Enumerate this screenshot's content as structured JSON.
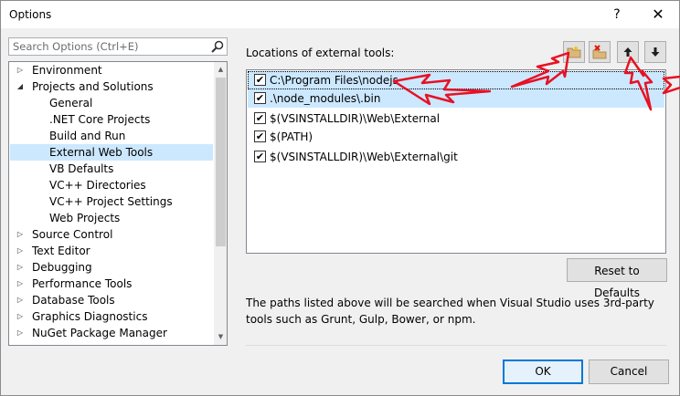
{
  "window": {
    "title": "Options",
    "help_glyph": "?",
    "close_glyph": "✕"
  },
  "search": {
    "placeholder": "Search Options (Ctrl+E)"
  },
  "tree": {
    "items": [
      {
        "label": "Environment",
        "expander": "▷"
      },
      {
        "label": "Projects and Solutions",
        "expander": "◢"
      },
      {
        "label": "General",
        "expander": ""
      },
      {
        "label": ".NET Core Projects",
        "expander": ""
      },
      {
        "label": "Build and Run",
        "expander": ""
      },
      {
        "label": "External Web Tools",
        "expander": "",
        "selected": true
      },
      {
        "label": "VB Defaults",
        "expander": ""
      },
      {
        "label": "VC++ Directories",
        "expander": ""
      },
      {
        "label": "VC++ Project Settings",
        "expander": ""
      },
      {
        "label": "Web Projects",
        "expander": ""
      },
      {
        "label": "Source Control",
        "expander": "▷"
      },
      {
        "label": "Text Editor",
        "expander": "▷"
      },
      {
        "label": "Debugging",
        "expander": "▷"
      },
      {
        "label": "Performance Tools",
        "expander": "▷"
      },
      {
        "label": "Database Tools",
        "expander": "▷"
      },
      {
        "label": "Graphics Diagnostics",
        "expander": "▷"
      },
      {
        "label": "NuGet Package Manager",
        "expander": "▷"
      }
    ]
  },
  "external_tools": {
    "label": "Locations of external tools:",
    "paths": [
      {
        "path": "C:\\Program Files\\nodejs",
        "checked": "✔"
      },
      {
        "path": ".\\node_modules\\.bin",
        "checked": "✔"
      },
      {
        "path": "$(VSINSTALLDIR)\\Web\\External",
        "checked": "✔"
      },
      {
        "path": "$(PATH)",
        "checked": "✔"
      },
      {
        "path": "$(VSINSTALLDIR)\\Web\\External\\git",
        "checked": "✔"
      }
    ],
    "reset_label": "Reset to Defaults",
    "description": "The paths listed above will be searched when Visual Studio uses 3rd-party tools such as Grunt, Gulp, Bower, or npm."
  },
  "footer": {
    "ok_label": "OK",
    "cancel_label": "Cancel"
  },
  "colors": {
    "selection": "#cce8ff",
    "accent": "#0078d7",
    "annotation_arrow": "#e81123",
    "folder": "#dcb67a",
    "delete_red": "#e51400"
  }
}
